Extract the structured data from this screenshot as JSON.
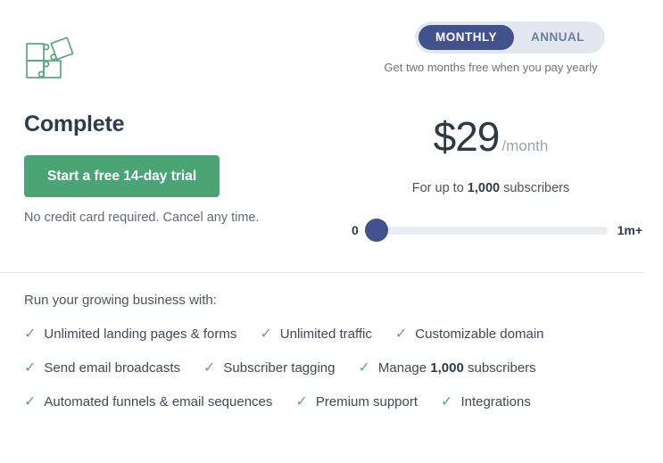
{
  "plan": {
    "icon": "puzzle-icon",
    "name": "Complete",
    "cta_label": "Start a free 14-day trial",
    "cta_note": "No credit card required. Cancel any time."
  },
  "billing": {
    "options": [
      {
        "label": "MONTHLY",
        "active": true
      },
      {
        "label": "ANNUAL",
        "active": false
      }
    ],
    "yearly_note": "Get two months free when you pay yearly"
  },
  "pricing": {
    "amount": "$29",
    "period": "/month",
    "subscribers_prefix": "For up to ",
    "subscribers_count": "1,000",
    "subscribers_suffix": " subscribers"
  },
  "slider": {
    "min_label": "0",
    "max_label": "1m+",
    "value_percent": 0
  },
  "features": {
    "title": "Run your growing business with:",
    "check_icon": "check-icon",
    "rows": [
      [
        {
          "text": "Unlimited landing pages & forms"
        },
        {
          "text": "Unlimited traffic"
        },
        {
          "text": "Customizable domain"
        }
      ],
      [
        {
          "text": "Send email broadcasts"
        },
        {
          "text": "Subscriber tagging"
        },
        {
          "prefix": "Manage ",
          "bold": "1,000",
          "suffix": " subscribers"
        }
      ],
      [
        {
          "text": "Automated funnels & email sequences"
        },
        {
          "text": "Premium support"
        },
        {
          "text": "Integrations"
        }
      ]
    ]
  },
  "colors": {
    "cta_green": "#4ba476",
    "toggle_active": "#41528c",
    "toggle_bg": "#e3e8f0",
    "slider_thumb": "#41528c",
    "slider_track": "#e9edf2",
    "check_green": "#5aa87e",
    "heading": "#2e3b4e"
  }
}
